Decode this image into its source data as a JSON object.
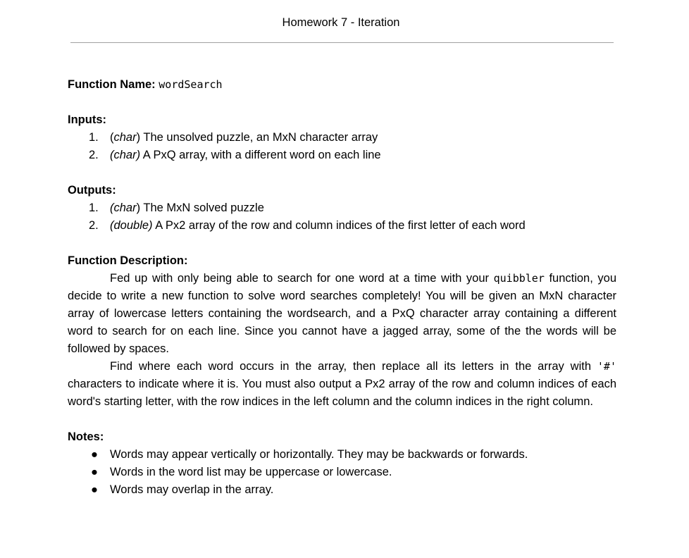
{
  "header": {
    "title": "Homework 7 - Iteration"
  },
  "function_name": {
    "label": "Function Name:",
    "value": "wordSearch"
  },
  "inputs": {
    "label": "Inputs:",
    "items": [
      {
        "marker": "1.",
        "type_open": "(",
        "type": "char",
        "type_close": ")",
        "text": " The unsolved puzzle, an MxN character array"
      },
      {
        "marker": "2.",
        "type_open": "",
        "type": "(char)",
        "type_close": "",
        "text": " A PxQ array, with a different word on each line"
      }
    ]
  },
  "outputs": {
    "label": "Outputs:",
    "items": [
      {
        "marker": "1.",
        "type": "(char",
        "type_close": ")",
        "text": " The MxN solved puzzle"
      },
      {
        "marker": "2.",
        "type": "(double)",
        "type_close": "",
        "text": " A Px2 array of the row and column indices of the first letter of each word"
      }
    ]
  },
  "description": {
    "label": "Function Description:",
    "para1_a": "Fed up with only being able to search for one word at a time with your ",
    "para1_code": "quibbler",
    "para1_b": " function, you decide to write a new function to solve word searches completely! You will be given an MxN character array of lowercase letters containing the wordsearch, and a PxQ character array containing a different word to search for on each line. Since you cannot have a jagged array, some of the the words will be followed by spaces.",
    "para2_a": "Find where each word occurs in the array, then replace all its letters in the array with ",
    "para2_code": "'#'",
    "para2_b": " characters to indicate where it is. You must also output a Px2 array of the row and column indices of each word's starting letter, with the row indices in the left column and the column indices in the right column."
  },
  "notes": {
    "label": "Notes:",
    "bullet": "●",
    "items": [
      "Words may appear vertically or horizontally. They may be backwards or forwards.",
      "Words in the word list may be uppercase or lowercase.",
      "Words may overlap in the array."
    ]
  }
}
